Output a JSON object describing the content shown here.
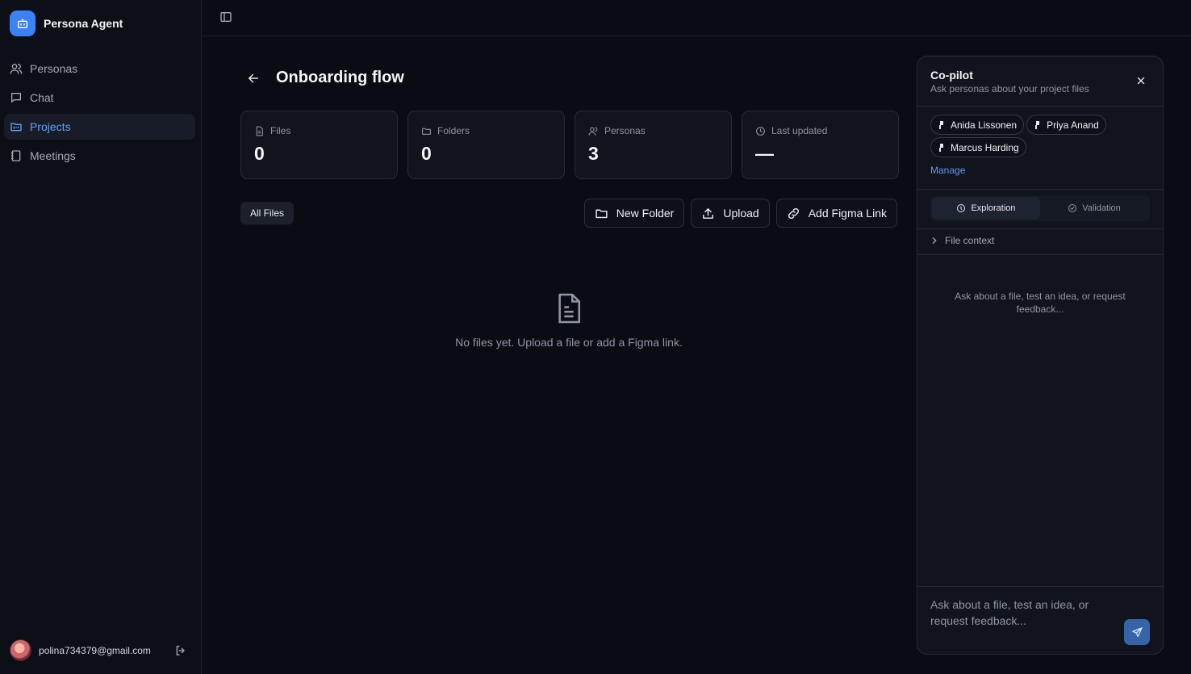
{
  "app": {
    "name": "Persona Agent",
    "accent": "#3b82f6"
  },
  "sidebar": {
    "items": [
      {
        "label": "Personas",
        "icon": "users-icon"
      },
      {
        "label": "Chat",
        "icon": "chat-icon"
      },
      {
        "label": "Projects",
        "icon": "folder-kanban-icon",
        "active": true
      },
      {
        "label": "Meetings",
        "icon": "notebook-icon"
      }
    ],
    "user_email": "polina734379@gmail.com"
  },
  "project": {
    "title": "Onboarding flow",
    "stats": [
      {
        "label": "Files",
        "value": "0",
        "icon": "file-icon"
      },
      {
        "label": "Folders",
        "value": "0",
        "icon": "folder-icon"
      },
      {
        "label": "Personas",
        "value": "3",
        "icon": "users-icon"
      },
      {
        "label": "Last updated",
        "value": "—",
        "icon": "clock-icon"
      }
    ],
    "filter_tab": "All Files",
    "actions": {
      "new_folder": "New Folder",
      "upload": "Upload",
      "add_figma": "Add Figma Link"
    },
    "empty_message": "No files yet. Upload a file or add a Figma link."
  },
  "copilot": {
    "title": "Co-pilot",
    "subtitle": "Ask personas about your project files",
    "personas": [
      "Anida Lissonen",
      "Priya Anand",
      "Marcus Harding"
    ],
    "manage_label": "Manage",
    "modes": [
      "Exploration",
      "Validation"
    ],
    "active_mode": "Exploration",
    "file_context_label": "File context",
    "empty_prompt": "Ask about a file, test an idea, or request feedback...",
    "input_placeholder": "Ask about a file, test an idea, or request feedback..."
  }
}
